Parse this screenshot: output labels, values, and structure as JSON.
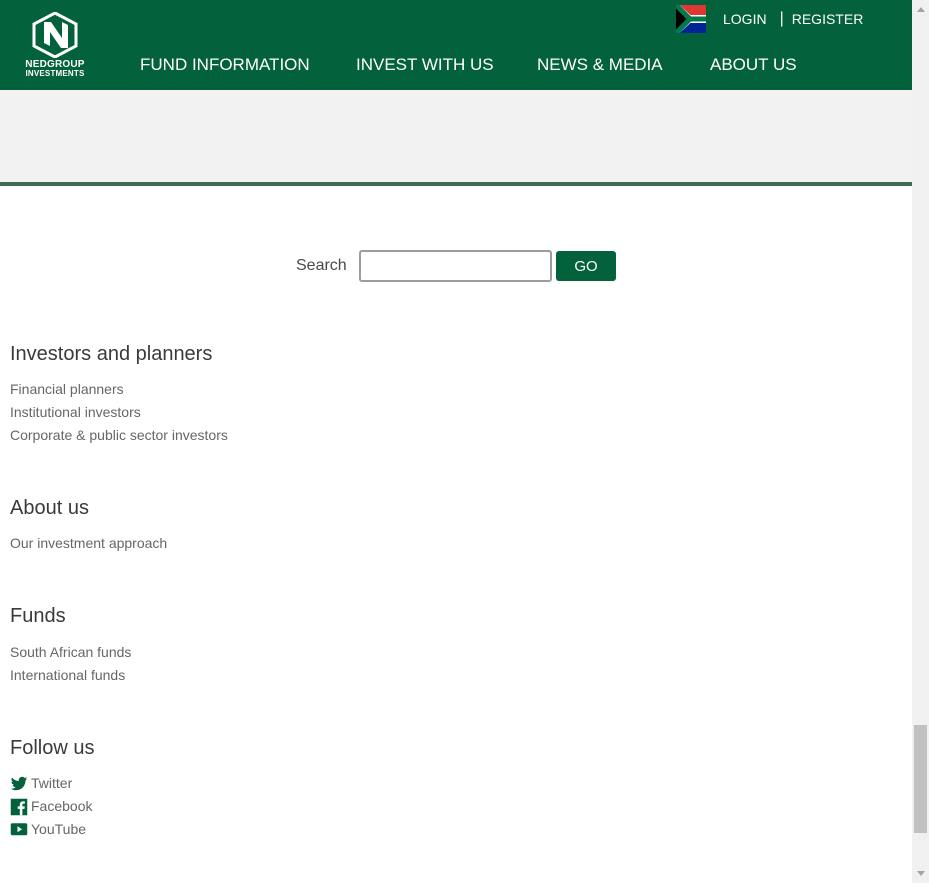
{
  "header": {
    "logo": {
      "line1": "NEDGROUP",
      "line2": "INVESTMENTS"
    },
    "country_flag": "south-africa-flag",
    "login_label": "LOGIN",
    "separator": "|",
    "register_label": "REGISTER",
    "nav": [
      {
        "label": "FUND INFORMATION"
      },
      {
        "label": "INVEST WITH US"
      },
      {
        "label": "NEWS & MEDIA"
      },
      {
        "label": "ABOUT US"
      }
    ],
    "brand_color": "#03613c"
  },
  "search": {
    "label": "Search",
    "value": "",
    "placeholder": "",
    "button_label": "GO"
  },
  "sections": {
    "investors": {
      "title": "Investors and planners",
      "links": [
        "Financial planners",
        "Institutional investors",
        "Corporate & public sector investors"
      ]
    },
    "about": {
      "title": "About us",
      "links": [
        "Our investment approach"
      ]
    },
    "funds": {
      "title": "Funds",
      "links": [
        "South African funds",
        "International funds"
      ]
    },
    "follow": {
      "title": "Follow us",
      "links": [
        {
          "label": "Twitter",
          "icon": "twitter-icon"
        },
        {
          "label": "Facebook",
          "icon": "facebook-icon"
        },
        {
          "label": "YouTube",
          "icon": "youtube-icon"
        }
      ]
    }
  }
}
